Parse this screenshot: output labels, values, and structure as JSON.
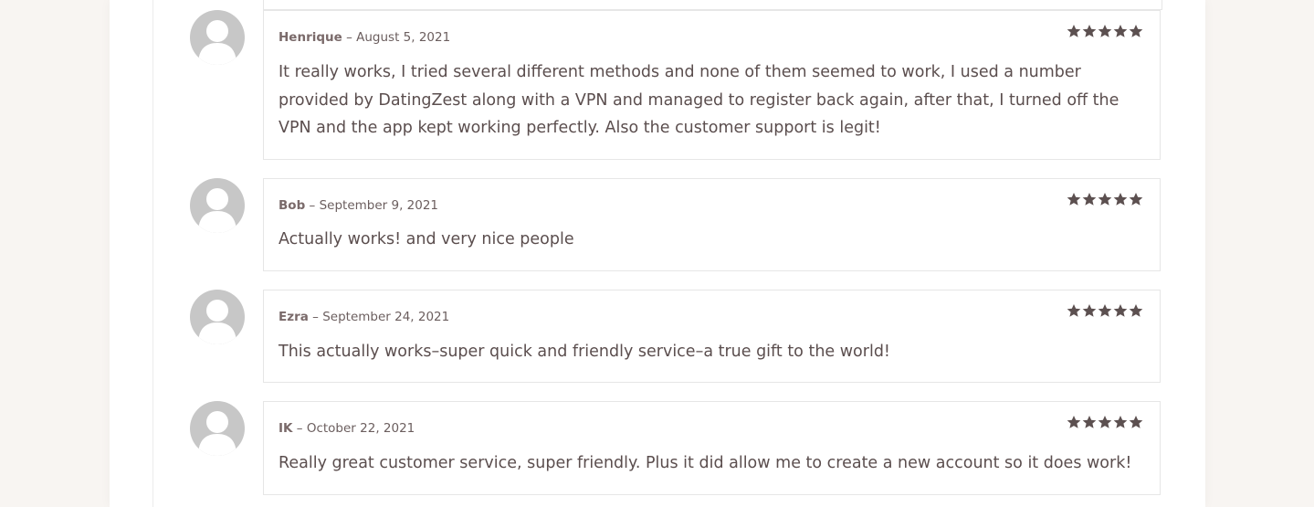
{
  "colors": {
    "star": "#5c5050",
    "avatar_bg": "#c7c7c7",
    "text": "#5b4e4e"
  },
  "reviews": [
    {
      "author": "Henrique",
      "date": "August 5, 2021",
      "rating": 5,
      "text": "It really works, I tried several different methods and none of them seemed to work, I used a number provided by DatingZest along with a VPN and managed to register back again, after that, I turned off the VPN and the app kept working perfectly. Also the customer support is legit!"
    },
    {
      "author": "Bob",
      "date": "September 9, 2021",
      "rating": 5,
      "text": "Actually works! and very nice people"
    },
    {
      "author": "Ezra",
      "date": "September 24, 2021",
      "rating": 5,
      "text": "This actually works–super quick and friendly service–a true gift to the world!"
    },
    {
      "author": "IK",
      "date": "October 22, 2021",
      "rating": 5,
      "text": "Really great customer service, super friendly. Plus it did allow me to create a new account so it does work!"
    }
  ]
}
